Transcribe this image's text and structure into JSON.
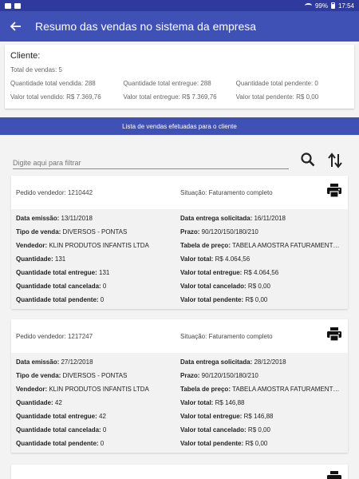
{
  "status_bar": {
    "battery": "99%",
    "time": "17:54"
  },
  "app_bar": {
    "title": "Resumo das vendas no sistema da empresa"
  },
  "client": {
    "title": "Cliente:",
    "total_vendas": "Total de vendas: 5",
    "qtd_vendida": "Quantidade total vendida: 288",
    "qtd_entregue": "Quantidade total entregue: 288",
    "qtd_pendente": "Quantidade total pendente: 0",
    "valor_vendido": "Valor total vendido: R$ 7.369,76",
    "valor_entregue": "Valor total entregue: R$ 7.369,76",
    "valor_pendente": "Valor total pendente: R$ 0,00"
  },
  "list_header": "Lista de vendas efetuadas para o cliente",
  "filter": {
    "placeholder": "Digite aqui para filtrar"
  },
  "icons": {
    "back": "arrow-left-icon",
    "search": "search-icon",
    "sort": "sort-icon",
    "print": "printer-icon"
  },
  "colors": {
    "primary": "#3f51b5",
    "status_bar": "#2f3a9e"
  },
  "orders": [
    {
      "pedido": "Pedido vendedor: 1210442",
      "situacao": "Situação: Faturamento completo",
      "rows": [
        [
          {
            "l": "Data emissão:",
            "v": " 13/11/2018"
          },
          {
            "l": "Data entrega solicitada:",
            "v": " 16/11/2018"
          }
        ],
        [
          {
            "l": "Tipo de venda:",
            "v": " DIVERSOS - PONTAS"
          },
          {
            "l": "Prazo:",
            "v": " 90/120/150/180/210"
          }
        ],
        [
          {
            "l": "Vendedor:",
            "v": " KLIN PRODUTOS INFANTIS LTDA"
          },
          {
            "l": "Tabela de preço:",
            "v": " TABELA  AMOSTRA FATURAMENTO ..."
          }
        ],
        [
          {
            "l": "Quantidade:",
            "v": " 131"
          },
          {
            "l": "Valor total:",
            "v": " R$ 4.064,56"
          }
        ],
        [
          {
            "l": "Quantidade total entregue:",
            "v": " 131"
          },
          {
            "l": "Valor total entregue:",
            "v": " R$ 4.064,56"
          }
        ],
        [
          {
            "l": "Quantidade total cancelada:",
            "v": " 0"
          },
          {
            "l": "Valor total cancelado:",
            "v": " R$ 0,00"
          }
        ],
        [
          {
            "l": "Quantidade total pendente:",
            "v": " 0"
          },
          {
            "l": "Valor total pendente:",
            "v": " R$ 0,00"
          }
        ]
      ]
    },
    {
      "pedido": "Pedido vendedor: 1217247",
      "situacao": "Situação: Faturamento completo",
      "rows": [
        [
          {
            "l": "Data emissão:",
            "v": " 27/12/2018"
          },
          {
            "l": "Data entrega solicitada:",
            "v": " 28/12/2018"
          }
        ],
        [
          {
            "l": "Tipo de venda:",
            "v": " DIVERSOS - PONTAS"
          },
          {
            "l": "Prazo:",
            "v": " 90/120/150/180/210"
          }
        ],
        [
          {
            "l": "Vendedor:",
            "v": " KLIN PRODUTOS INFANTIS LTDA"
          },
          {
            "l": "Tabela de preço:",
            "v": " TABELA  AMOSTRA FATURAMENTO ..."
          }
        ],
        [
          {
            "l": "Quantidade:",
            "v": " 42"
          },
          {
            "l": "Valor total:",
            "v": " R$ 146,88"
          }
        ],
        [
          {
            "l": "Quantidade total entregue:",
            "v": " 42"
          },
          {
            "l": "Valor total entregue:",
            "v": " R$ 146,88"
          }
        ],
        [
          {
            "l": "Quantidade total cancelada:",
            "v": " 0"
          },
          {
            "l": "Valor total cancelado:",
            "v": " R$ 0,00"
          }
        ],
        [
          {
            "l": "Quantidade total pendente:",
            "v": " 0"
          },
          {
            "l": "Valor total pendente:",
            "v": " R$ 0,00"
          }
        ]
      ]
    }
  ]
}
